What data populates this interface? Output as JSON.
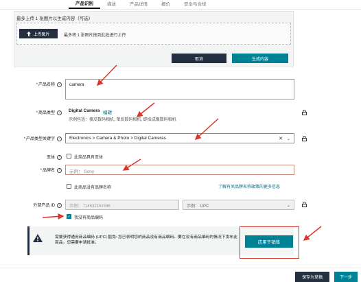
{
  "tabs": [
    {
      "label": "产品识别",
      "active": true
    },
    {
      "label": "描述",
      "active": false
    },
    {
      "label": "产品详情",
      "active": false
    },
    {
      "label": "报价",
      "active": false
    },
    {
      "label": "安全与合规",
      "active": false
    }
  ],
  "upload": {
    "top_text": "最多上传 1 张图片以生成内容（可选）",
    "button_label": "上传图片",
    "hint": "最多将 1 张图片拖到此处进行上传",
    "cancel_label": "取消",
    "generate_label": "生成内容"
  },
  "product_name": {
    "label": "产品名称",
    "value": "camera"
  },
  "product_type": {
    "label": "商品类型",
    "value": "Digital Camera",
    "edit_label": "编辑",
    "example": "示例包括：傻瓜数码相机, 单反数码相机, 即拍成像数码相机"
  },
  "product_keyword": {
    "label": "产品类型关键字",
    "value": "Electronics > Camera & Photo > Digital Cameras",
    "clear_icon": "✕",
    "chevron_icon": "⌄"
  },
  "variation": {
    "label": "变体",
    "checkbox_label": "此商品具有变体"
  },
  "brand": {
    "label": "品牌名",
    "placeholder": "示例： Sony",
    "no_brand_label": "此商品没有品牌名称",
    "link_text": "了解有关品牌名称政策的更多信息"
  },
  "external_id": {
    "label": "外部产品 ID",
    "placeholder": "示例： 714532191586",
    "type_placeholder": "示例： UPC",
    "no_code_label": "我没有商品编码"
  },
  "alert": {
    "text": "需要获得通用商品编码 (UPC) 豁免: 您已表明您的商品没有商品编码。要在没有商品编码的情况下发布此商品，您需要申请批准。",
    "apply_label": "应用于销售"
  },
  "footer": {
    "draft_label": "保存为草稿",
    "next_label": "下一步"
  },
  "colors": {
    "primary_dark": "#232f3e",
    "teal": "#008296",
    "annotation_red": "#d9362b"
  }
}
